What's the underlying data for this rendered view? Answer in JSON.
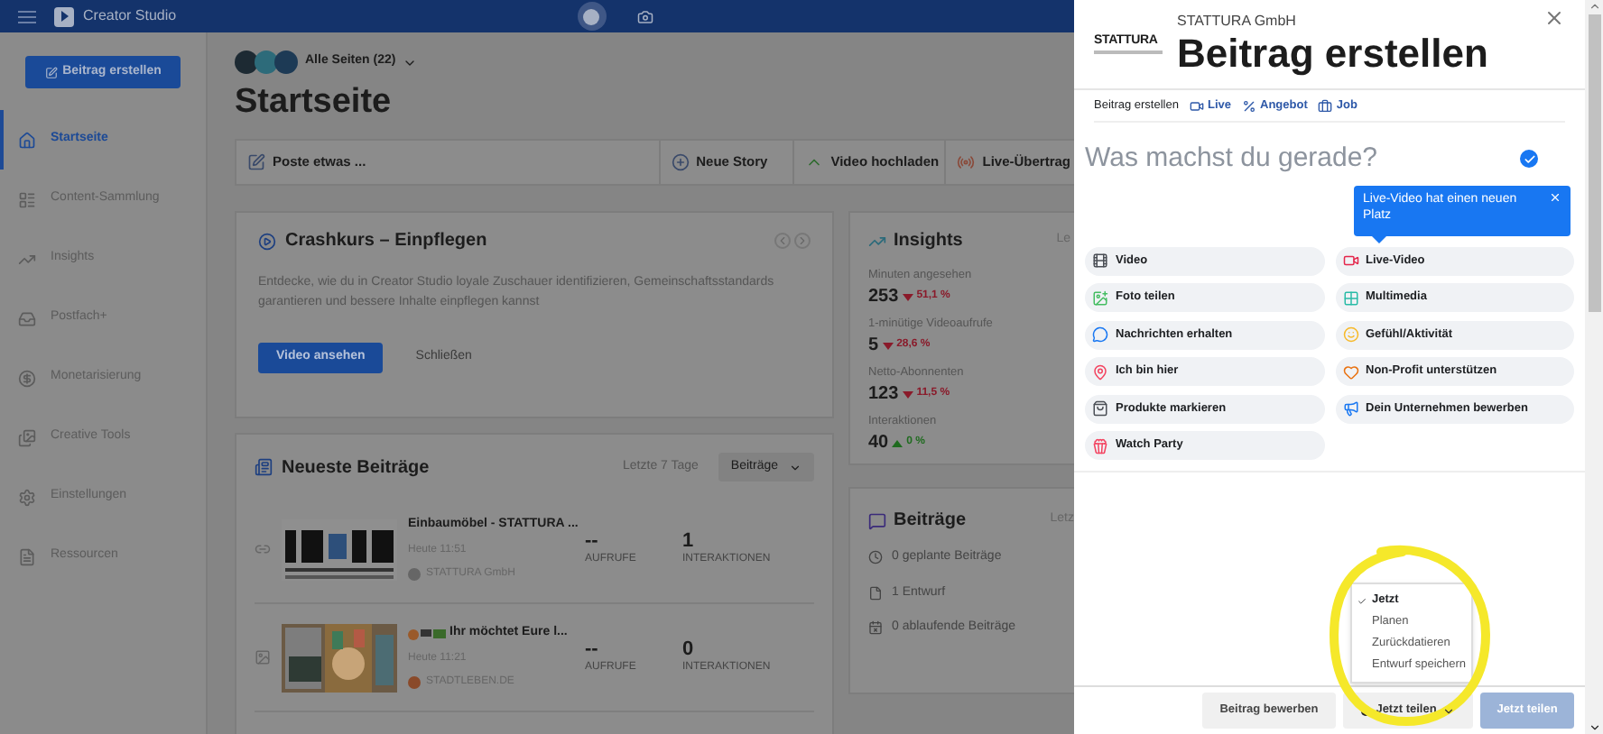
{
  "header": {
    "title": "Creator Studio",
    "platforms": [
      {
        "selected": true
      },
      {
        "selected": false
      }
    ]
  },
  "sidebar": {
    "create_button": "Beitrag erstellen",
    "items": [
      {
        "label": "Startseite",
        "selected": true
      },
      {
        "label": "Content-Sammlung",
        "selected": false
      },
      {
        "label": "Insights",
        "selected": false
      },
      {
        "label": "Postfach+",
        "selected": false
      },
      {
        "label": "Monetarisierung",
        "selected": false
      },
      {
        "label": "Creative Tools",
        "selected": false
      },
      {
        "label": "Einstellungen",
        "selected": false
      },
      {
        "label": "Ressourcen",
        "selected": false
      }
    ]
  },
  "page_selector": "Alle Seiten (22)",
  "page_title": "Startseite",
  "composer_bar": [
    "Poste etwas ...",
    "Neue Story",
    "Video hochladen",
    "Live-Übertrag"
  ],
  "crash_course": {
    "title": "Crashkurs – Einpflegen",
    "text": "Entdecke, wie du in Creator Studio loyale Zuschauer identifizieren, Gemeinschaftsstandards garantieren und bessere Inhalte einpflegen kannst",
    "buttons": [
      "Video ansehen",
      "Schließen"
    ]
  },
  "latest_posts": {
    "title": "Neueste Beiträge",
    "range": "Letzte 7 Tage",
    "filter": "Beiträge",
    "posts": [
      {
        "title": "Einbaumöbel - STATTURA ...",
        "time": "Heute 11:51",
        "page": "STATTURA GmbH",
        "views": "--",
        "views_label": "AUFRUFE",
        "interactions": "1",
        "interactions_label": "INTERAKTIONEN"
      },
      {
        "title": "Ihr möchtet Eure l...",
        "time": "Heute 11:21",
        "page": "STADTLEBEN.DE",
        "views": "--",
        "views_label": "AUFRUFE",
        "interactions": "0",
        "interactions_label": "INTERAKTIONEN"
      }
    ]
  },
  "insights": {
    "title": "Insights",
    "range": "Le",
    "metrics": [
      {
        "label": "Minuten angesehen",
        "value": "253",
        "change": "51,1 %",
        "rising": false
      },
      {
        "label": "1-minütige Videoaufrufe",
        "value": "5",
        "change": "28,6 %",
        "rising": false
      },
      {
        "label": "Netto-Abonnenten",
        "value": "123",
        "change": "11,5 %",
        "rising": false
      },
      {
        "label": "Interaktionen",
        "value": "40",
        "change": "0 %",
        "rising": true
      }
    ]
  },
  "posts_summary": {
    "title": "Beiträge",
    "range": "Letz",
    "items": [
      "0 geplante Beiträge",
      "1 Entwurf",
      "0 ablaufende Beiträge"
    ]
  },
  "create_post": {
    "logo": "STATTURA",
    "page_name": "STATTURA GmbH",
    "title": "Beitrag erstellen",
    "post_types": [
      {
        "label": "Beitrag erstellen",
        "selected": true
      },
      {
        "label": "Live",
        "selected": false
      },
      {
        "label": "Angebot",
        "selected": false
      },
      {
        "label": "Job",
        "selected": false
      }
    ],
    "placeholder": "Was machst du gerade?",
    "tooltip": "Live-Video hat einen neuen Platz",
    "options": [
      "Video",
      "Live-Video",
      "Foto teilen",
      "Multimedia",
      "Nachrichten erhalten",
      "Gefühl/Aktivität",
      "Ich bin hier",
      "Non-Profit unterstützen",
      "Produkte markieren",
      "Dein Unternehmen bewerben",
      "Watch Party"
    ],
    "promote_button": "Beitrag bewerben",
    "share_dropdown": "Jetzt teilen",
    "share_button": "Jetzt teilen",
    "share_menu": [
      {
        "label": "Jetzt",
        "selected": true
      },
      {
        "label": "Planen",
        "selected": false
      },
      {
        "label": "Zurückdatieren",
        "selected": false
      },
      {
        "label": "Entwurf speichern",
        "selected": false
      }
    ]
  }
}
